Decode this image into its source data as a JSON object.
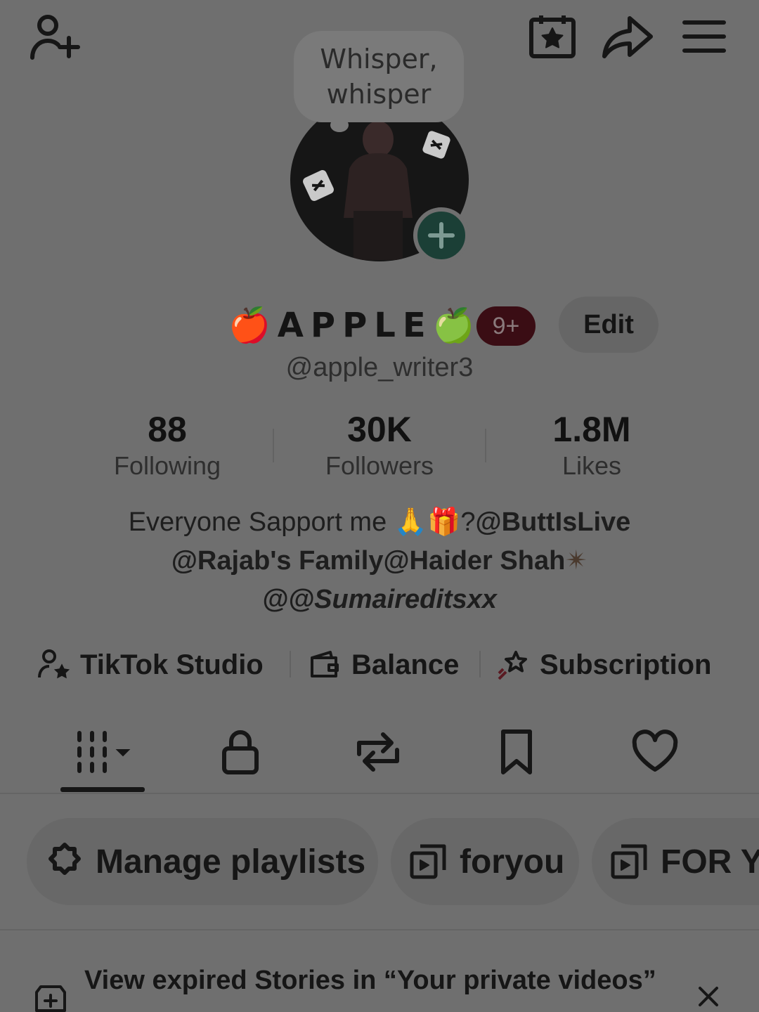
{
  "top_bar": {
    "add_friend_icon": "person-plus-icon",
    "calendar_icon": "calendar-star-icon",
    "share_icon": "share-arrow-icon",
    "menu_icon": "hamburger-menu-icon"
  },
  "whisper_bubble": {
    "text": "Whisper, whisper"
  },
  "profile": {
    "name_prefix_emoji": "🍎",
    "display_name": "APPLE",
    "name_suffix_emoji": "🍏",
    "notification_badge": "9+",
    "edit_label": "Edit",
    "username": "@apple_writer3"
  },
  "stats": [
    {
      "value": "88",
      "label": "Following"
    },
    {
      "value": "30K",
      "label": "Followers"
    },
    {
      "value": "1.8M",
      "label": "Likes"
    }
  ],
  "bio": {
    "line1_text": "Everyone Sapport me 🙏🎁?",
    "line1_mention": "@ButtIsLive",
    "line2_mention": "@Rajab's Family@Haider Shah",
    "line2_emoji": "✴",
    "line3_mention": "@@Sumaireditsxx"
  },
  "quick_links": [
    {
      "label": "TikTok Studio",
      "icon": "person-star-icon"
    },
    {
      "label": "Balance",
      "icon": "wallet-icon"
    },
    {
      "label": "Subscription",
      "icon": "star-shooting-icon"
    }
  ],
  "tabs": [
    {
      "name": "videos-grid",
      "icon": "grid-dropdown-icon",
      "active": true
    },
    {
      "name": "private",
      "icon": "lock-icon"
    },
    {
      "name": "reposts",
      "icon": "repost-icon"
    },
    {
      "name": "favorites",
      "icon": "bookmark-icon"
    },
    {
      "name": "liked",
      "icon": "heart-icon"
    }
  ],
  "playlists": [
    {
      "label": "Manage playlists",
      "icon": "gear-icon"
    },
    {
      "label": "foryou",
      "icon": "playlist-icon"
    },
    {
      "label": "FOR YO",
      "icon": "playlist-icon"
    }
  ],
  "banner": {
    "text": "View expired Stories in “Your private videos”",
    "icon": "story-plus-icon",
    "close_icon": "close-icon"
  },
  "colors": {
    "overlay_bg": "#6f6f6f",
    "avatar_badge": "#1b3f36",
    "notif_badge": "#3a0d14"
  }
}
